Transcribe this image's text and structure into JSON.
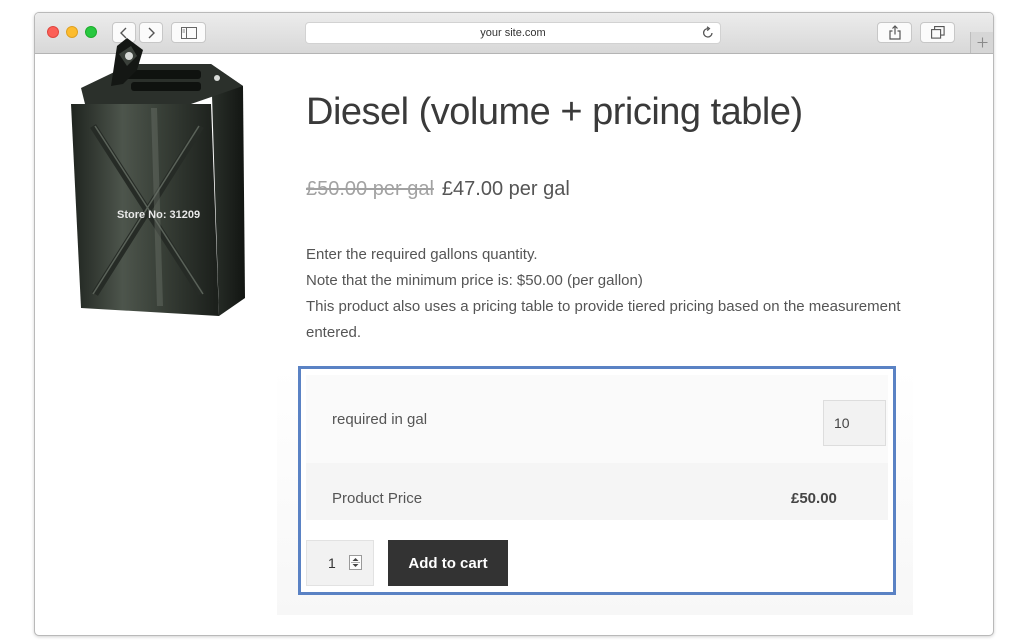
{
  "browser": {
    "url": "your site.com"
  },
  "product": {
    "title": "Diesel (volume + pricing table)",
    "image_text": "Store No: 31209",
    "price": {
      "old": "£50.00 per gal",
      "current": "£47.00 per gal"
    },
    "description": [
      "Enter the required gallons quantity.",
      "Note that the minimum price is: $50.00 (per gallon)",
      "This product also uses a pricing table to provide tiered pricing based on the measurement entered."
    ]
  },
  "measurement": {
    "label": "required in gal",
    "value": "10"
  },
  "product_price": {
    "label": "Product Price",
    "value": "£50.00"
  },
  "cart": {
    "quantity": "1",
    "add_label": "Add to cart"
  },
  "icons": {
    "back": "chevron-left-icon",
    "forward": "chevron-right-icon",
    "sidebar": "sidebar-icon",
    "reload": "reload-icon",
    "share": "share-icon",
    "tabs": "tabs-icon",
    "new_tab": "plus-icon"
  },
  "colors": {
    "highlight_border": "#5a82c4",
    "button_bg": "#333333",
    "old_price": "#a2a2a2"
  }
}
